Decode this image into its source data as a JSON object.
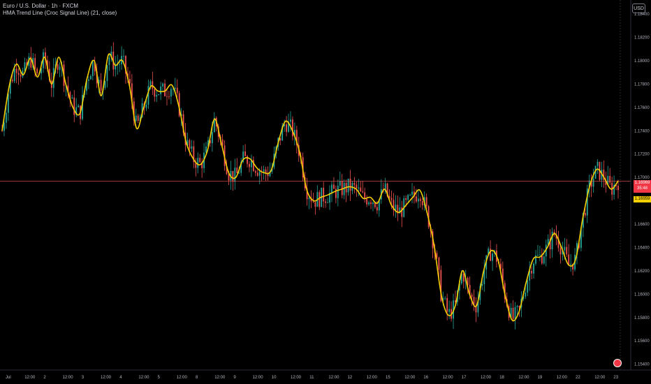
{
  "legend": {
    "symbol": "Euro / U.S. Dollar · 1h · FXCM",
    "indicator": "HMA Trend Line (Croc Signal Line) (21, close)"
  },
  "currency": "USD",
  "price_tags": {
    "last": "1.16969",
    "countdown": "35:48",
    "hma": "1.16959"
  },
  "colors": {
    "up": "#26a69a",
    "down": "#ef5350",
    "hma": "#f5d000",
    "last_line": "#ef5350",
    "axis_text": "#b2b5be"
  },
  "chart_data": {
    "type": "line",
    "title": "",
    "series": [
      {
        "name": "HMA Trend Line (Croc Signal Line) (21, close)",
        "points": [
          [
            "Jul 1 00:00",
            1.174
          ],
          [
            "1 05:00",
            1.1778
          ],
          [
            "1 10:00",
            1.1797
          ],
          [
            "1 14:00",
            1.1788
          ],
          [
            "1 17:00",
            1.1802
          ],
          [
            "1 22:00",
            1.1786
          ],
          [
            "2 02:00",
            1.1803
          ],
          [
            "2 06:00",
            1.178
          ],
          [
            "2 09:00",
            1.1803
          ],
          [
            "2 14:00",
            1.178
          ],
          [
            "2 19:00",
            1.176
          ],
          [
            "2 22:00",
            1.1755
          ],
          [
            "3 03:00",
            1.1785
          ],
          [
            "3 07:00",
            1.18
          ],
          [
            "3 10:00",
            1.177
          ],
          [
            "3 14:00",
            1.1805
          ],
          [
            "3 18:00",
            1.1796
          ],
          [
            "3 22:00",
            1.18
          ],
          [
            "4 02:00",
            1.1778
          ],
          [
            "4 06:00",
            1.1742
          ],
          [
            "4 10:00",
            1.176
          ],
          [
            "4 14:00",
            1.1778
          ],
          [
            "4 20:00",
            1.1774
          ],
          [
            "5 02:00",
            1.1774
          ],
          [
            "5 07:00",
            1.1779
          ],
          [
            "5 12:00",
            1.176
          ],
          [
            "5 16:00",
            1.173
          ],
          [
            "5 20:00",
            1.1716
          ],
          [
            "8 00:00",
            1.1711
          ],
          [
            "8 04:00",
            1.1723
          ],
          [
            "8 08:00",
            1.175
          ],
          [
            "8 12:00",
            1.1728
          ],
          [
            "8 16:00",
            1.1704
          ],
          [
            "8 20:00",
            1.17
          ],
          [
            "9 00:00",
            1.1715
          ],
          [
            "9 04:00",
            1.1716
          ],
          [
            "9 08:00",
            1.1708
          ],
          [
            "9 12:00",
            1.1704
          ],
          [
            "9 16:00",
            1.1706
          ],
          [
            "9 20:00",
            1.173
          ],
          [
            "10 00:00",
            1.1748
          ],
          [
            "10 04:00",
            1.174
          ],
          [
            "10 08:00",
            1.1722
          ],
          [
            "10 12:00",
            1.169
          ],
          [
            "10 16:00",
            1.168
          ],
          [
            "10 20:00",
            1.1683
          ],
          [
            "11 00:00",
            1.1685
          ],
          [
            "11 04:00",
            1.1688
          ],
          [
            "11 08:00",
            1.169
          ],
          [
            "11 12:00",
            1.1692
          ],
          [
            "11 16:00",
            1.169
          ],
          [
            "11 20:00",
            1.1682
          ],
          [
            "14 00:00",
            1.1683
          ],
          [
            "14 04:00",
            1.1678
          ],
          [
            "14 08:00",
            1.169
          ],
          [
            "14 12:00",
            1.1676
          ],
          [
            "14 16:00",
            1.167
          ],
          [
            "14 20:00",
            1.1676
          ],
          [
            "15 00:00",
            1.1683
          ],
          [
            "15 04:00",
            1.1689
          ],
          [
            "15 08:00",
            1.167
          ],
          [
            "15 12:00",
            1.1642
          ],
          [
            "15 16:00",
            1.16
          ],
          [
            "15 20:00",
            1.1582
          ],
          [
            "16 00:00",
            1.159
          ],
          [
            "16 04:00",
            1.162
          ],
          [
            "16 08:00",
            1.16
          ],
          [
            "16 12:00",
            1.159
          ],
          [
            "16 16:00",
            1.162
          ],
          [
            "16 20:00",
            1.1637
          ],
          [
            "17 00:00",
            1.163
          ],
          [
            "17 04:00",
            1.16
          ],
          [
            "17 08:00",
            1.1578
          ],
          [
            "17 12:00",
            1.1585
          ],
          [
            "17 16:00",
            1.161
          ],
          [
            "17 20:00",
            1.163
          ],
          [
            "18 00:00",
            1.1632
          ],
          [
            "18 04:00",
            1.164
          ],
          [
            "18 08:00",
            1.1652
          ],
          [
            "18 12:00",
            1.164
          ],
          [
            "18 16:00",
            1.1625
          ],
          [
            "18 20:00",
            1.163
          ],
          [
            "21 00:00",
            1.1665
          ],
          [
            "21 04:00",
            1.1693
          ],
          [
            "21 08:00",
            1.1707
          ],
          [
            "21 12:00",
            1.17
          ],
          [
            "21 16:00",
            1.169
          ],
          [
            "21 20:00",
            1.1697
          ]
        ]
      }
    ],
    "candles_summary": "hourly OHLC bars, green up / red down",
    "x_ticks": [
      "Jul",
      "12:00",
      "2",
      "12:00",
      "3",
      "12:00",
      "4",
      "12:00",
      "5",
      "12:00",
      "8",
      "12:00",
      "9",
      "12:00",
      "10",
      "12:00",
      "11",
      "12:00",
      "12",
      "12:00",
      "15",
      "12:00",
      "16",
      "12:00",
      "17",
      "12:00",
      "18",
      "12:00",
      "19",
      "12:00",
      "22",
      "12:00",
      "23"
    ],
    "y_ticks": [
      "1.18400",
      "1.18200",
      "1.18000",
      "1.17800",
      "1.17600",
      "1.17400",
      "1.17200",
      "1.17000",
      "1.16800",
      "1.16600",
      "1.16400",
      "1.16200",
      "1.16000",
      "1.15800",
      "1.15600",
      "1.15400"
    ],
    "y_tick_values": [
      1.184,
      1.182,
      1.18,
      1.178,
      1.176,
      1.174,
      1.172,
      1.17,
      1.168,
      1.166,
      1.164,
      1.162,
      1.16,
      1.158,
      1.156,
      1.154
    ],
    "ylim": [
      1.1535,
      1.1852
    ],
    "last_price": 1.16969,
    "hma_last": 1.16959,
    "grid": false
  }
}
